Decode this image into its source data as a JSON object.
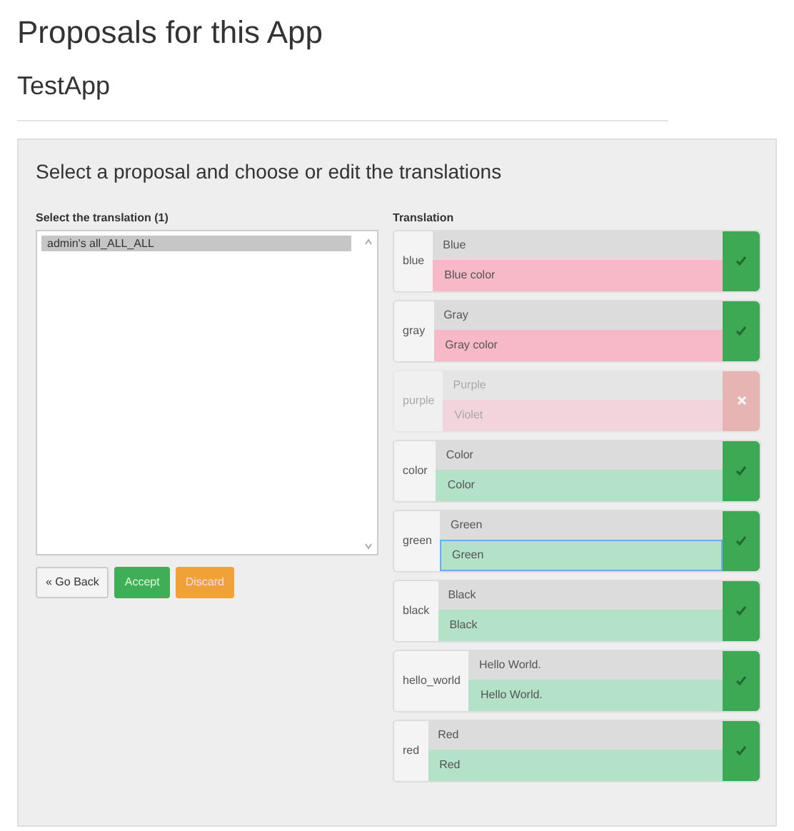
{
  "page_title": "Proposals for this App",
  "app_name": "TestApp",
  "panel": {
    "heading": "Select a proposal and choose or edit the translations",
    "list": {
      "label": "Select the translation (1)",
      "items": [
        {
          "text": "admin's all_ALL_ALL",
          "selected": true
        }
      ]
    },
    "buttons": [
      {
        "label": "« Go Back",
        "kind": "back"
      },
      {
        "label": "Accept",
        "kind": "accept"
      },
      {
        "label": "Discard",
        "kind": "discard"
      }
    ],
    "translation": {
      "label": "Translation",
      "rows": [
        {
          "key": "blue",
          "source": "Blue",
          "target": "Blue color",
          "modified": true,
          "accepted": true,
          "disabled": false,
          "focused": false
        },
        {
          "key": "gray",
          "source": "Gray",
          "target": "Gray color",
          "modified": true,
          "accepted": true,
          "disabled": false,
          "focused": false
        },
        {
          "key": "purple",
          "source": "Purple",
          "target": "Violet",
          "modified": true,
          "accepted": false,
          "disabled": true,
          "focused": false
        },
        {
          "key": "color",
          "source": "Color",
          "target": "Color",
          "modified": false,
          "accepted": true,
          "disabled": false,
          "focused": false
        },
        {
          "key": "green",
          "source": "Green",
          "target": "Green",
          "modified": false,
          "accepted": true,
          "disabled": false,
          "focused": true
        },
        {
          "key": "black",
          "source": "Black",
          "target": "Black",
          "modified": false,
          "accepted": true,
          "disabled": false,
          "focused": false
        },
        {
          "key": "hello_world",
          "source": "Hello World.",
          "target": "Hello World.",
          "modified": false,
          "accepted": true,
          "disabled": false,
          "focused": false
        },
        {
          "key": "red",
          "source": "Red",
          "target": "Red",
          "modified": false,
          "accepted": true,
          "disabled": false,
          "focused": false
        }
      ]
    }
  }
}
